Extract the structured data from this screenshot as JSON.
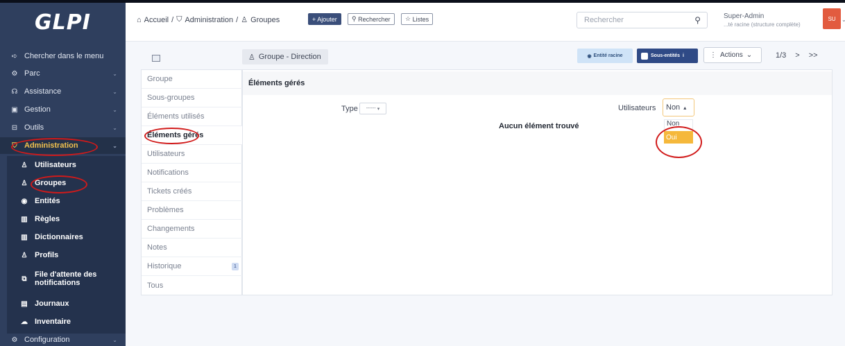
{
  "app": {
    "logo": "GLPI"
  },
  "sidebar": {
    "items": [
      {
        "label": "Chercher dans le menu",
        "icon": "arrow-right-icon"
      },
      {
        "label": "Parc",
        "icon": "gear-icon"
      },
      {
        "label": "Assistance",
        "icon": "headset-icon"
      },
      {
        "label": "Gestion",
        "icon": "wallet-icon"
      },
      {
        "label": "Outils",
        "icon": "briefcase-icon"
      },
      {
        "label": "Administration",
        "icon": "shield-icon"
      }
    ],
    "sub_items": [
      {
        "label": "Utilisateurs",
        "icon": "user-icon"
      },
      {
        "label": "Groupes",
        "icon": "users-icon"
      },
      {
        "label": "Entités",
        "icon": "eye-icon"
      },
      {
        "label": "Règles",
        "icon": "book-icon"
      },
      {
        "label": "Dictionnaires",
        "icon": "book-icon"
      },
      {
        "label": "Profils",
        "icon": "user-check-icon"
      },
      {
        "label": "File d'attente des",
        "label2": "notifications",
        "icon": "notification-icon"
      },
      {
        "label": "Journaux",
        "icon": "log-icon"
      },
      {
        "label": "Inventaire",
        "icon": "cloud-icon"
      }
    ],
    "config": {
      "label": "Configuration",
      "icon": "settings-icon"
    }
  },
  "header": {
    "breadcrumb": [
      "Accueil",
      "Administration",
      "Groupes"
    ],
    "separator": "/",
    "add_label": "+ Ajouter",
    "search_btn_label": "Rechercher",
    "lists_label": "Listes",
    "search_placeholder": "Rechercher",
    "user_name": "Super-Admin",
    "user_entity": "...té racine (structure complète)",
    "avatar_initials": "SU"
  },
  "toolbar": {
    "object_title": "Groupe - Direction",
    "entity_chip": "Entité racine",
    "subentities_chip": "Sous-entités",
    "subentities_info": "i",
    "actions_label": "Actions",
    "pager": "1/3",
    "next": ">",
    "last": ">>"
  },
  "tabs": [
    {
      "label": "Groupe"
    },
    {
      "label": "Sous-groupes"
    },
    {
      "label": "Éléments utilisés"
    },
    {
      "label": "Éléments gérés",
      "active": true
    },
    {
      "label": "Utilisateurs"
    },
    {
      "label": "Notifications"
    },
    {
      "label": "Tickets créés"
    },
    {
      "label": "Problèmes"
    },
    {
      "label": "Changements"
    },
    {
      "label": "Notes"
    },
    {
      "label": "Historique",
      "badge": "1"
    },
    {
      "label": "Tous"
    }
  ],
  "main": {
    "section_title": "Éléments gérés",
    "type_label": "Type",
    "type_value": "------",
    "users_label": "Utilisateurs",
    "users_value": "Non",
    "users_options": [
      "Non",
      "Oui"
    ],
    "empty_message": "Aucun élément trouvé"
  },
  "colors": {
    "sidebar_bg": "#2f3f5e",
    "accent": "#3a4e7a",
    "highlight": "#f5b83b",
    "annotation_red": "#d11a1a"
  }
}
